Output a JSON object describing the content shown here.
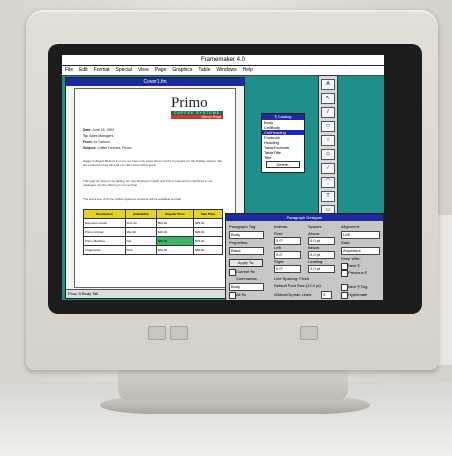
{
  "window": {
    "title": "Framemaker 4.0"
  },
  "menu": [
    "File",
    "Edit",
    "Format",
    "Special",
    "View",
    "Page",
    "Graphics",
    "Table",
    "Windows",
    "Help"
  ],
  "document": {
    "title": "Cover1.fm",
    "logo": {
      "word": "Primo",
      "band": "COFFEE SYSTEMS",
      "band2": "Silicon Road"
    },
    "memo": [
      [
        "Date:",
        "June 15, 1993"
      ],
      [
        "To:",
        "Sales Managers"
      ],
      [
        "From:",
        "Jo Carlson"
      ],
      [
        "Subject:",
        "Coffee Devices, Prices"
      ]
    ],
    "para1": "Happy holidays! Believe it or not, we have only a few short months to prepare for the holiday season. We are excited and we think all our sale items will be good.",
    "para2": "This year we hope to be adding our new Espresso Coach and Primo Cappuccino machines to our catalogue, but the offering is not yet final.",
    "para3": "The entire line of Primo Coffee Systems products will be available at retail",
    "table_headers": [
      "Description",
      "Availability",
      "Regular Price",
      "Sale Price"
    ],
    "table_rows": [
      [
        "Espresso Coach",
        "First 10",
        "$59.00",
        "$49.00"
      ],
      [
        "Primo Grinder",
        "Mar 30",
        "$39.00",
        "$29.00"
      ],
      [
        "Primo Machine",
        "Net",
        "$89.00",
        "$79.00"
      ],
      [
        "Cappuccino",
        "First",
        "$69.00",
        "$59.00"
      ]
    ],
    "status": "Flow: A  Body   Tall"
  },
  "catalog": {
    "title": "¶ Catalog",
    "items": [
      "Body",
      "CellBody",
      "CellHeading",
      "Footnote",
      "Heading",
      "TableFootnote",
      "TableTitle",
      "Title"
    ],
    "selected": 2,
    "delete": "Delete..."
  },
  "toolbox": {
    "label": "Tools",
    "tools": [
      "A",
      "↖",
      "/",
      "□",
      "○",
      "◇",
      "∕",
      "⌒",
      "T",
      "▭",
      "≡",
      "∿"
    ]
  },
  "para_designer": {
    "title": "Paragraph Designer",
    "labels": {
      "tag": "Paragraph Tag:",
      "indents": "Indents:",
      "first": "First:",
      "left": "Left:",
      "right": "Right:",
      "spaces": "Spaces:",
      "above": "Above:",
      "below": "Below:",
      "leading": "Leading:",
      "alignment": "Alignment:",
      "start": "Start:",
      "keep": "Keep With:",
      "properties": "Properties:",
      "line": "Line Spacing:",
      "fixed": "Fixed",
      "font": "Default Font Size (12.0 pt)",
      "widow": "Widow/Orphan Lines:",
      "hyph": "Hyphenate",
      "next": "Next ¶",
      "prev": "Previous ¶",
      "ctag": "Next ¶ Tag:",
      "commands": "Commands:"
    },
    "values": {
      "tag": "Body",
      "props": "Basic",
      "first": "0.0\"",
      "left": "0.0\"",
      "right": "0.0\"",
      "above": "0.0 pt",
      "below": "0.0 pt",
      "leading": "2.0 pt",
      "alignment": "Left",
      "start": "Anywhere",
      "tagged": "Body",
      "widow": "3"
    },
    "buttons": {
      "apply": "Apply To:",
      "current": "Current ¶s",
      "all": "All ¶s",
      "update": "Update"
    }
  }
}
